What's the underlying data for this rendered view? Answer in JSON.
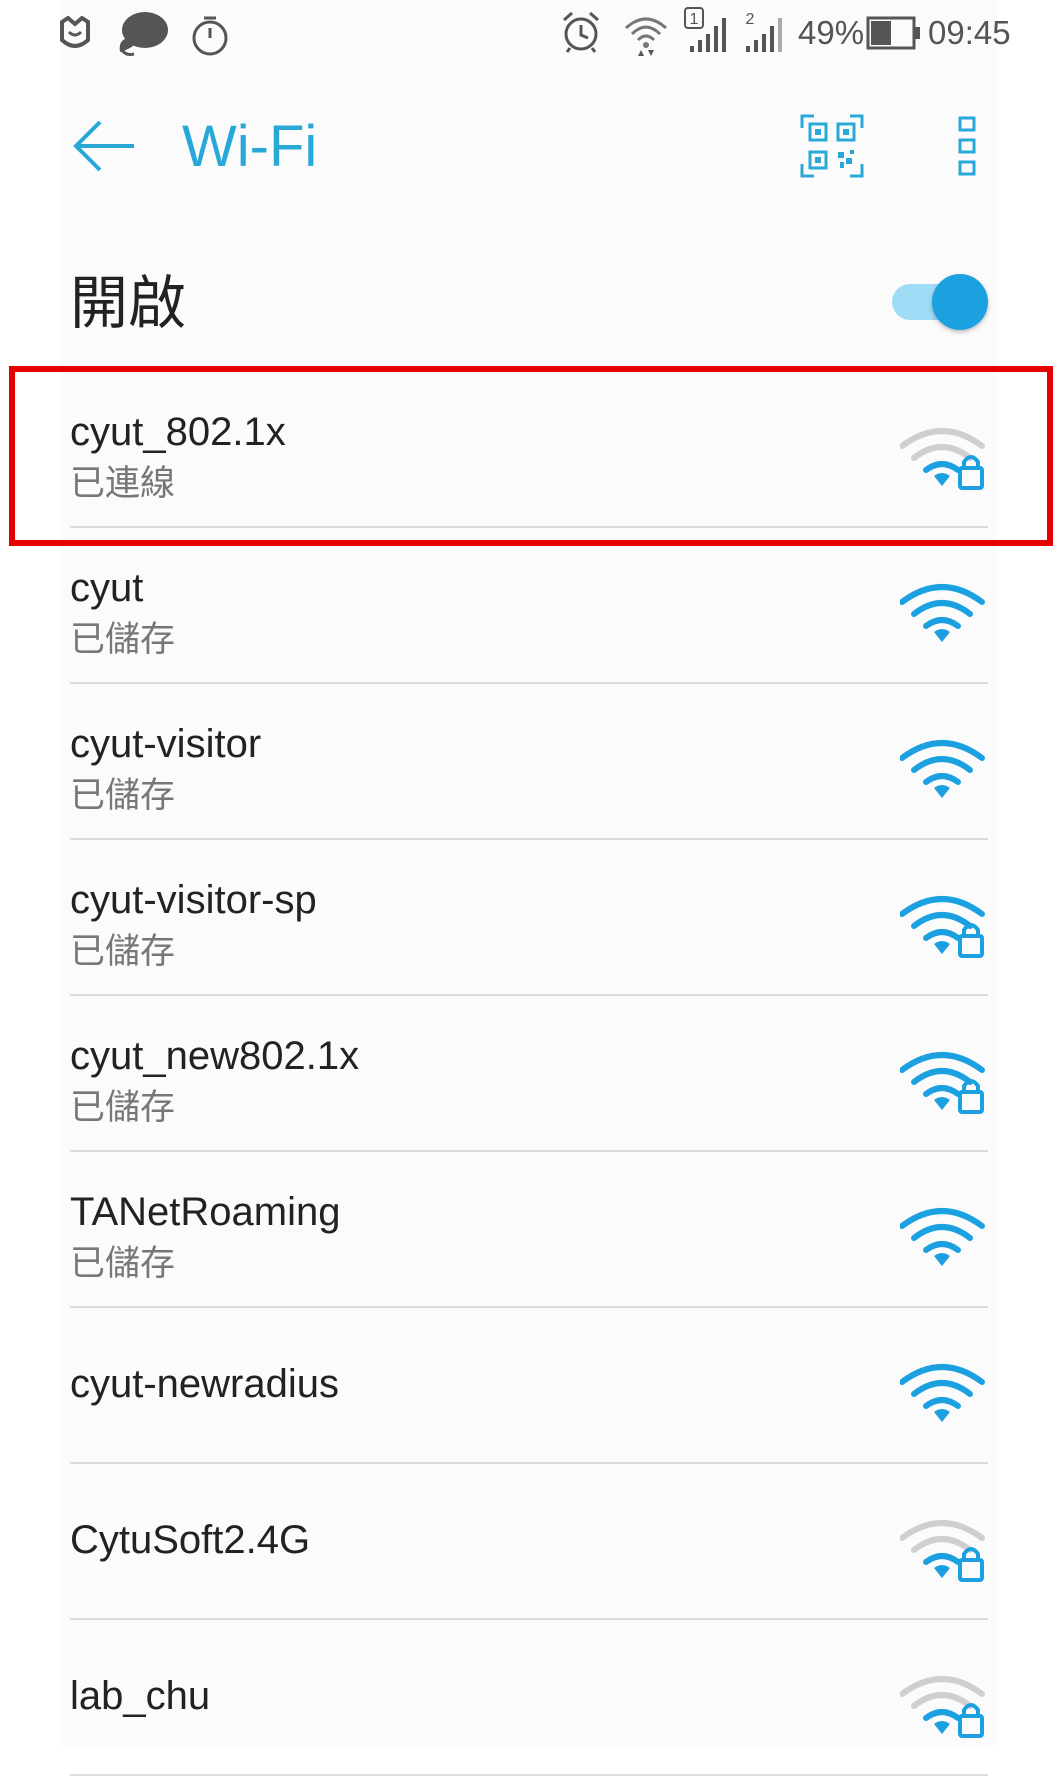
{
  "status_bar": {
    "battery_percent": "49%",
    "time": "09:45",
    "sim1_label": "1",
    "sim2_label": "2",
    "battery_level": 0.49
  },
  "header": {
    "title": "Wi-Fi"
  },
  "wifi_toggle": {
    "label": "開啟",
    "on": true
  },
  "networks": [
    {
      "ssid": "cyut_802.1x",
      "status": "已連線",
      "secured": true,
      "signal": "weak"
    },
    {
      "ssid": "cyut",
      "status": "已儲存",
      "secured": false,
      "signal": "full"
    },
    {
      "ssid": "cyut-visitor",
      "status": "已儲存",
      "secured": false,
      "signal": "full"
    },
    {
      "ssid": "cyut-visitor-sp",
      "status": "已儲存",
      "secured": true,
      "signal": "full"
    },
    {
      "ssid": "cyut_new802.1x",
      "status": "已儲存",
      "secured": true,
      "signal": "full"
    },
    {
      "ssid": "TANetRoaming",
      "status": "已儲存",
      "secured": false,
      "signal": "full"
    },
    {
      "ssid": "cyut-newradius",
      "status": "",
      "secured": false,
      "signal": "full"
    },
    {
      "ssid": "CytuSoft2.4G",
      "status": "",
      "secured": true,
      "signal": "weak"
    },
    {
      "ssid": "lab_chu",
      "status": "",
      "secured": true,
      "signal": "weak"
    }
  ],
  "colors": {
    "accent": "#29a8d8",
    "wifi_active": "#1ba0e0",
    "wifi_weak": "#cfcfcf",
    "highlight": "#e60000"
  }
}
